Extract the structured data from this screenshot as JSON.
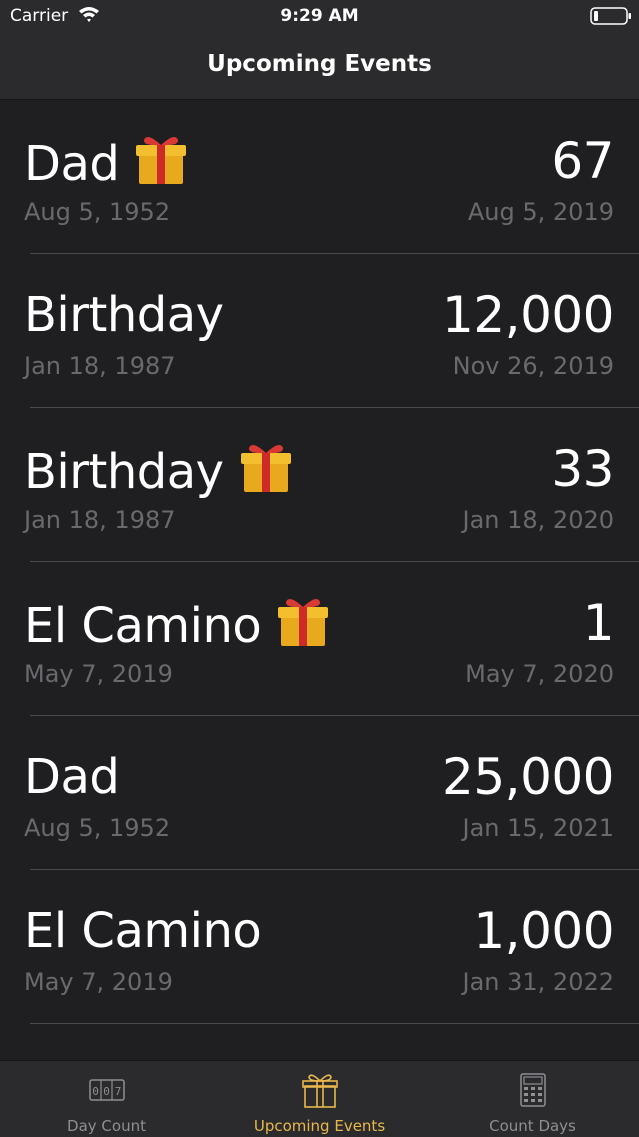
{
  "status_bar": {
    "carrier": "Carrier",
    "time": "9:29 AM"
  },
  "nav": {
    "title": "Upcoming Events"
  },
  "events": [
    {
      "name": "Dad",
      "gift": true,
      "count": "67",
      "start_date": "Aug 5, 1952",
      "target_date": "Aug 5, 2019"
    },
    {
      "name": "Birthday",
      "gift": false,
      "count": "12,000",
      "start_date": "Jan 18, 1987",
      "target_date": "Nov 26, 2019"
    },
    {
      "name": "Birthday",
      "gift": true,
      "count": "33",
      "start_date": "Jan 18, 1987",
      "target_date": "Jan 18, 2020"
    },
    {
      "name": "El Camino",
      "gift": true,
      "count": "1",
      "start_date": "May 7, 2019",
      "target_date": "May 7, 2020"
    },
    {
      "name": "Dad",
      "gift": false,
      "count": "25,000",
      "start_date": "Aug 5, 1952",
      "target_date": "Jan 15, 2021"
    },
    {
      "name": "El Camino",
      "gift": false,
      "count": "1,000",
      "start_date": "May 7, 2019",
      "target_date": "Jan 31, 2022"
    }
  ],
  "tabs": [
    {
      "label": "Day Count",
      "icon": "counter-icon",
      "active": false
    },
    {
      "label": "Upcoming Events",
      "icon": "gift-icon",
      "active": true
    },
    {
      "label": "Count Days",
      "icon": "calculator-icon",
      "active": false
    }
  ],
  "colors": {
    "accent": "#e8b84a",
    "background": "#1f1f21",
    "bar": "#2b2b2d",
    "secondary_text": "#6a6a6e"
  }
}
